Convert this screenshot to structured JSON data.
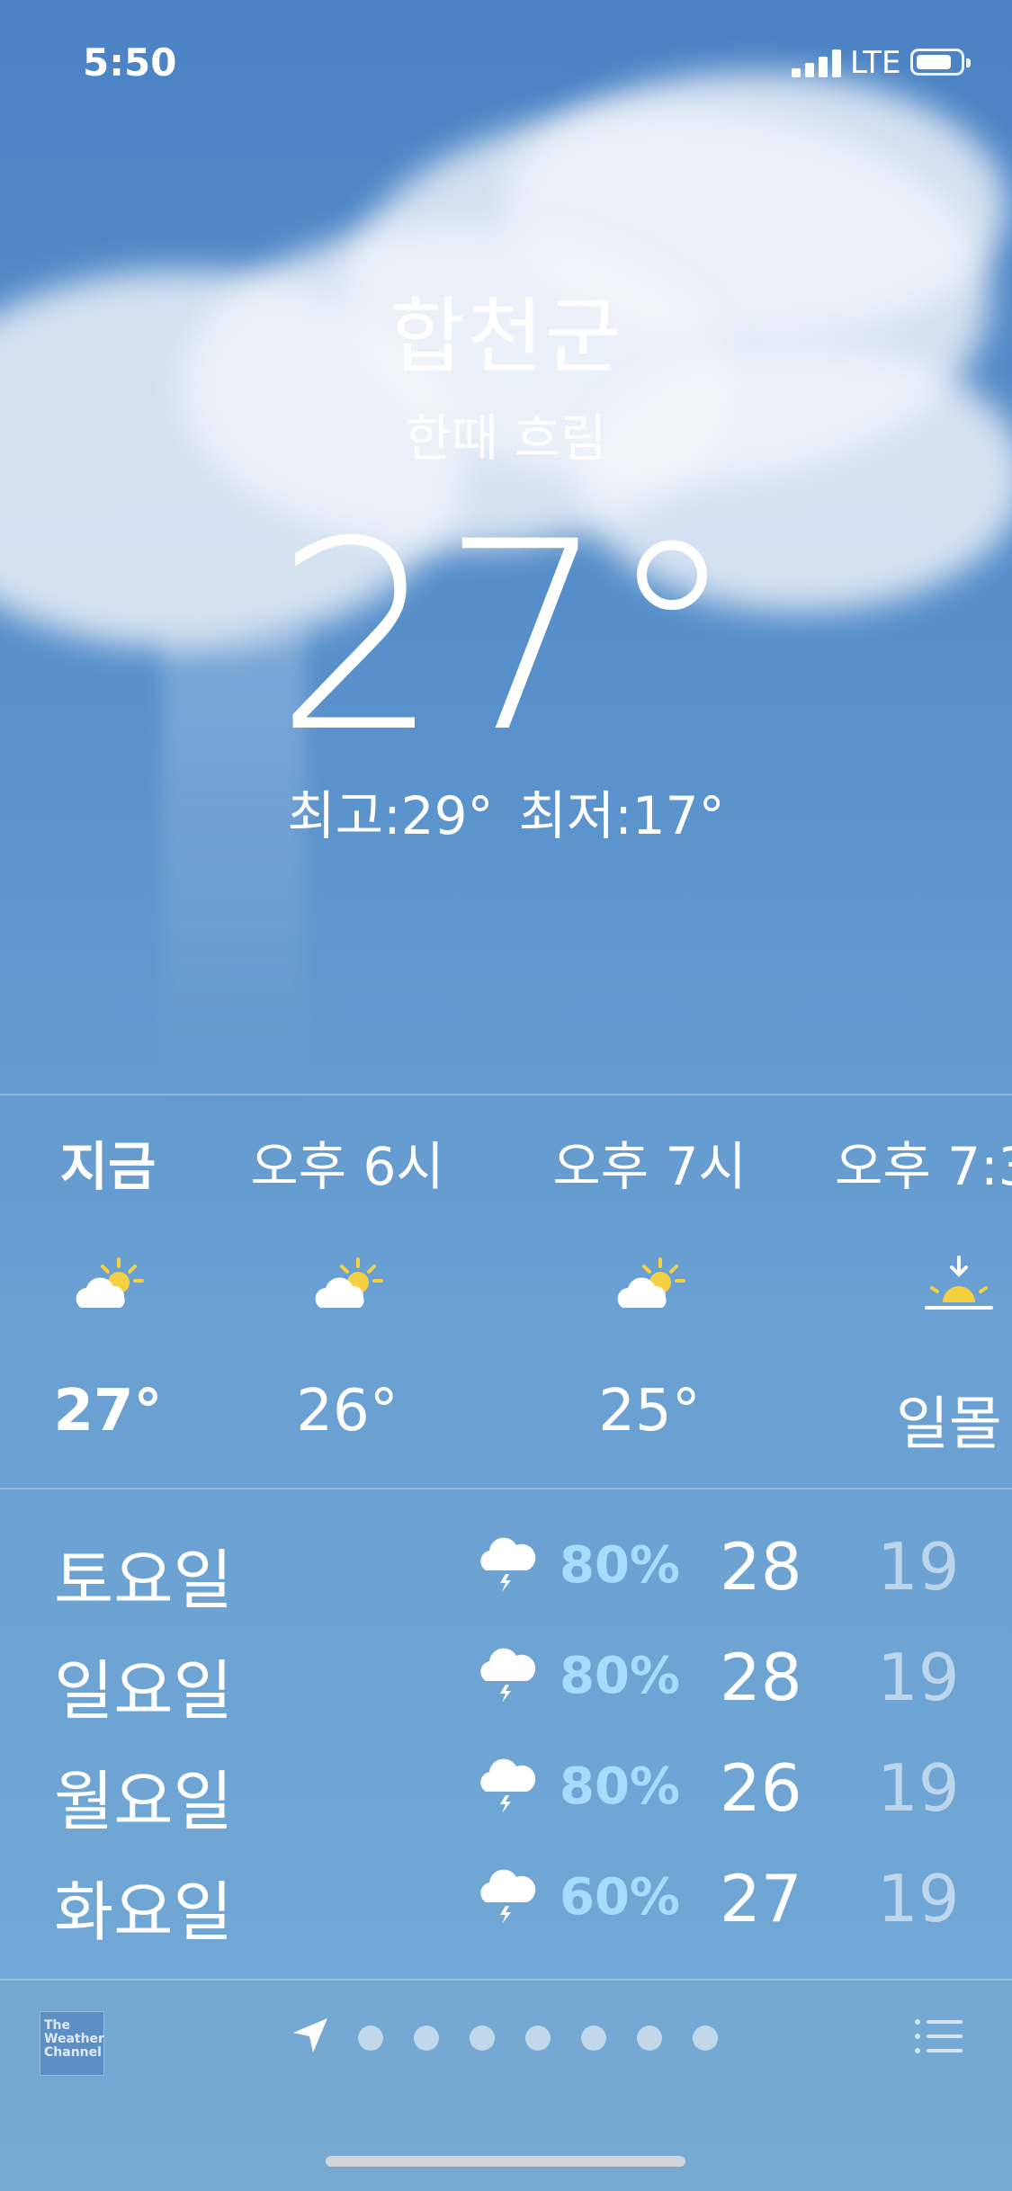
{
  "status_bar": {
    "time": "5:50",
    "network": "LTE"
  },
  "location": {
    "city": "합천군",
    "condition": "한때 흐림",
    "temperature": "27°",
    "high": "최고:29°",
    "low": "최저:17°"
  },
  "hourly": [
    {
      "label": "지금",
      "icon": "partly-cloudy-day-icon",
      "temp": "27°"
    },
    {
      "label": "오후 6시",
      "icon": "partly-cloudy-day-icon",
      "temp": "26°"
    },
    {
      "label": "오후 7시",
      "icon": "partly-cloudy-day-icon",
      "temp": "25°"
    },
    {
      "label": "오후 7:3",
      "icon": "sunset-icon",
      "temp": "일몰"
    }
  ],
  "daily": [
    {
      "day": "토요일",
      "icon": "thunderstorm-icon",
      "chance": "80%",
      "high": "28",
      "low": "19"
    },
    {
      "day": "일요일",
      "icon": "thunderstorm-icon",
      "chance": "80%",
      "high": "28",
      "low": "19"
    },
    {
      "day": "월요일",
      "icon": "thunderstorm-icon",
      "chance": "80%",
      "high": "26",
      "low": "19"
    },
    {
      "day": "화요일",
      "icon": "thunderstorm-icon",
      "chance": "60%",
      "high": "27",
      "low": "19"
    }
  ],
  "bottom_bar": {
    "provider_logo": "The Weather Channel",
    "page_dots": 7
  },
  "colors": {
    "precip": "#a7dcff",
    "sun": "#f6d043"
  }
}
